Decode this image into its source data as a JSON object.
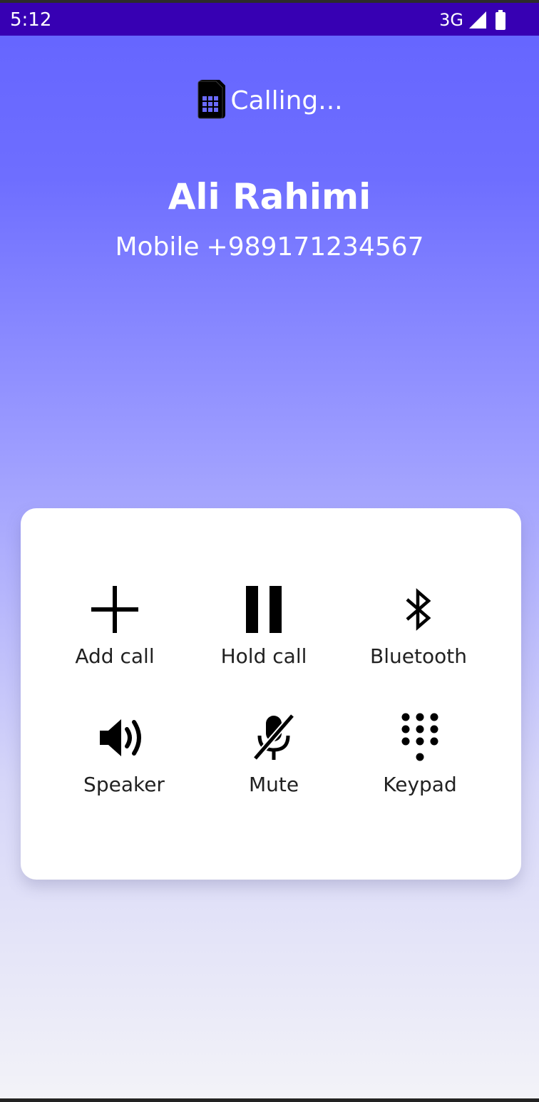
{
  "status_bar": {
    "time": "5:12",
    "network": "3G",
    "icons": [
      "signal-icon",
      "battery-icon"
    ]
  },
  "call": {
    "status": "Calling...",
    "status_icon": "sim-card-icon",
    "contact_name": "Ali Rahimi",
    "number_type": "Mobile",
    "number": "+989171234567"
  },
  "controls": {
    "add_call": {
      "label": "Add call",
      "icon": "add-icon"
    },
    "hold_call": {
      "label": "Hold call",
      "icon": "pause-icon"
    },
    "bluetooth": {
      "label": "Bluetooth",
      "icon": "bluetooth-icon"
    },
    "speaker": {
      "label": "Speaker",
      "icon": "speaker-icon"
    },
    "mute": {
      "label": "Mute",
      "icon": "mic-off-icon"
    },
    "keypad": {
      "label": "Keypad",
      "icon": "dialpad-icon"
    }
  },
  "colors": {
    "status_bar": "#3700b3",
    "gradient_top": "#6464ff",
    "gradient_bottom": "#f3f3f8",
    "card": "#ffffff",
    "text_on_gradient": "#ffffff",
    "text_on_card": "#212121"
  }
}
